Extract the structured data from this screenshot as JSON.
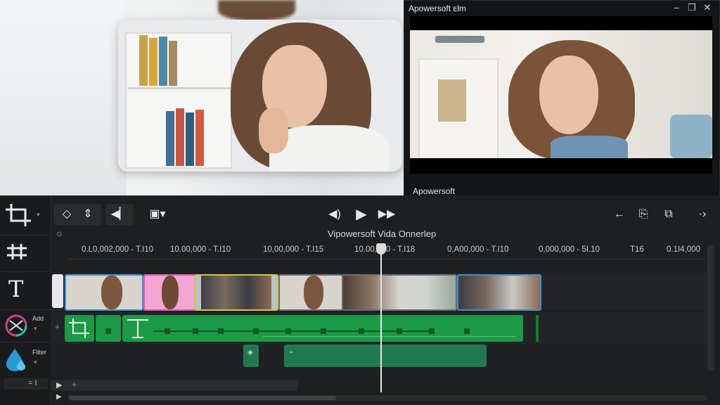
{
  "player": {
    "title": "Apowersoft ᴇlm",
    "footer": "Apowersoft",
    "controls": [
      "–",
      "❐",
      "✕"
    ]
  },
  "editor": {
    "timeline_title": "Vipowersoft Vida Onnerlep",
    "ruler_ticks": [
      "0.L0,002,000 - T.I10",
      "10.00,000 - T.I10",
      "10,00,000 - T.I15",
      "10.00,000 - T.I18",
      "0,A00,000 - T.I10",
      "0,000,000 - 5I.10",
      "T16",
      "0.1I4,000"
    ],
    "tools": {
      "add_label": "Add",
      "filter_label": "Filter",
      "bottom_label": "= I"
    },
    "icons": {
      "crop": "crop-icon",
      "adjust": "adjust-icon",
      "text": "text-icon",
      "add": "color-wheel-icon",
      "filter": "droplet-icon"
    }
  },
  "colors": {
    "accent_green": "#1c9a45",
    "clip_blue_border": "#3b8fd6",
    "clip_pink_border": "#e25ab6",
    "clip_yellow_border": "#d9c23a",
    "filter_bar": "#1f7a52"
  }
}
